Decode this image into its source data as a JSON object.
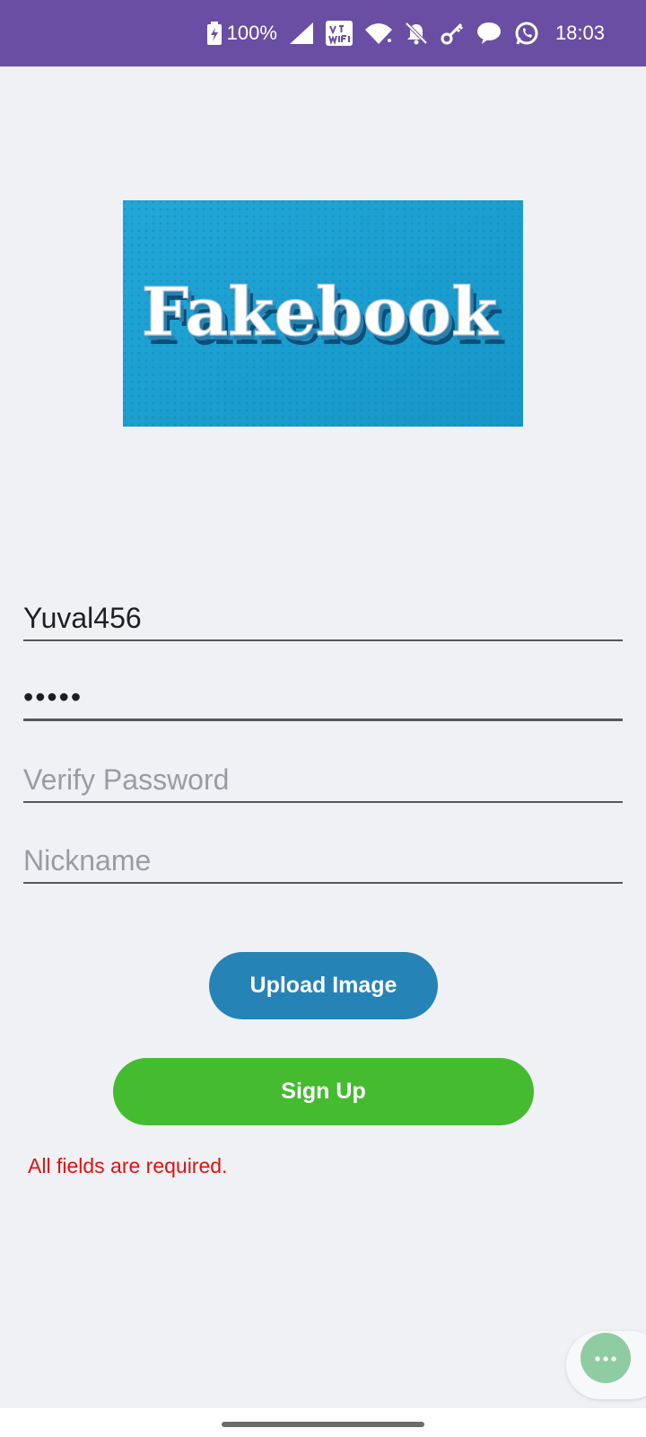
{
  "status_bar": {
    "battery_percent": "100%",
    "time": "18:03",
    "icons": [
      "battery-charging-icon",
      "signal-icon",
      "vowifi-icon",
      "wifi-icon",
      "mute-icon",
      "key-icon",
      "chat-bubble-icon",
      "whatsapp-icon"
    ],
    "background": "#6a4ea3"
  },
  "logo": {
    "text": "Fakebook",
    "background": "#1a9fcf"
  },
  "form": {
    "username_value": "Yuval456",
    "password_value": "•••••",
    "verify_placeholder": "Verify Password",
    "nickname_placeholder": "Nickname"
  },
  "buttons": {
    "upload_label": "Upload Image",
    "signup_label": "Sign Up",
    "upload_color": "#2683b5",
    "signup_color": "#45bb2f"
  },
  "error": {
    "text": "All fields are required.",
    "color": "#e0120e"
  },
  "fab": {
    "icon": "more-dots-icon",
    "color": "#8fcca1"
  }
}
